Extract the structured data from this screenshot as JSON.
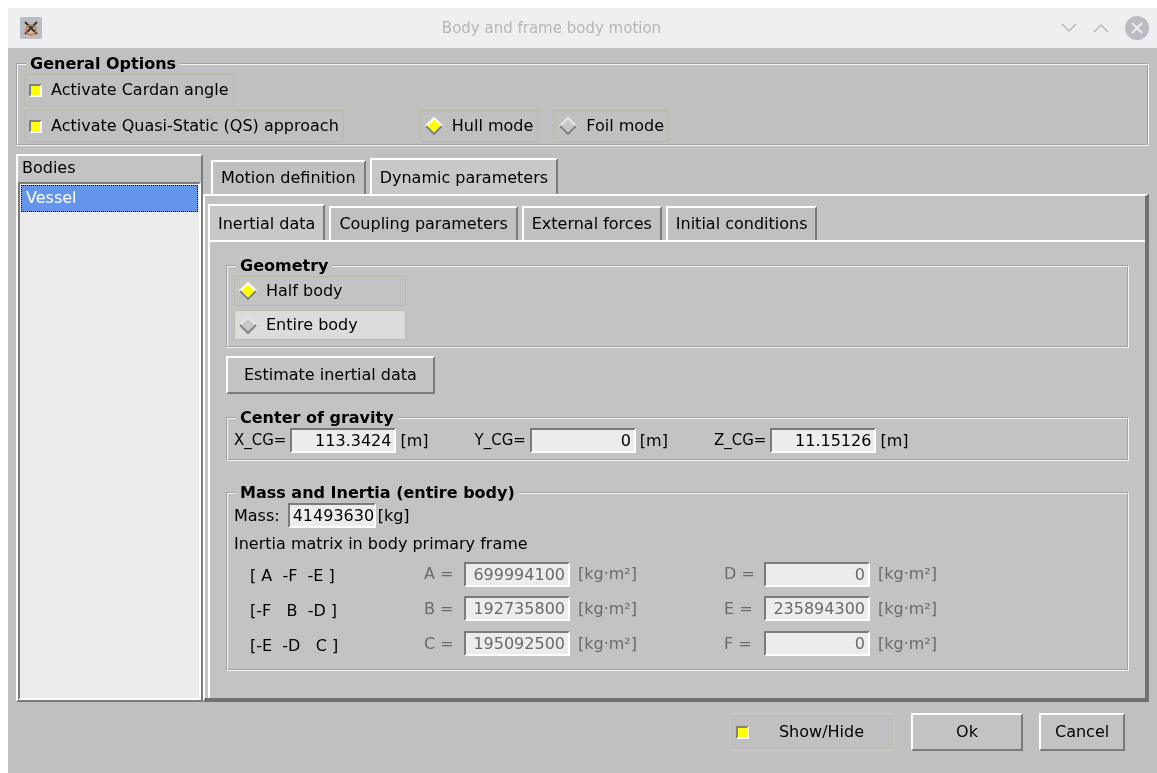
{
  "window": {
    "title": "Body and frame body motion"
  },
  "general_options": {
    "title": "General Options",
    "checkboxes": [
      {
        "label": "Activate Cardan angle",
        "checked": true
      },
      {
        "label": "Activate Quasi-Static (QS) approach",
        "checked": true
      }
    ],
    "modes": [
      {
        "label": "Hull mode",
        "selected": true
      },
      {
        "label": "Foil mode",
        "selected": false
      }
    ]
  },
  "bodies": {
    "title": "Bodies",
    "items": [
      {
        "label": "Vessel",
        "selected": true
      }
    ]
  },
  "tabs": [
    {
      "label": "Motion definition",
      "selected": false
    },
    {
      "label": "Dynamic parameters",
      "selected": true
    }
  ],
  "subtabs": [
    {
      "label": "Inertial data",
      "selected": true
    },
    {
      "label": "Coupling parameters",
      "selected": false
    },
    {
      "label": "External forces",
      "selected": false
    },
    {
      "label": "Initial conditions",
      "selected": false
    }
  ],
  "geometry": {
    "title": "Geometry",
    "options": [
      {
        "label": "Half body",
        "selected": true
      },
      {
        "label": "Entire body",
        "selected": false
      }
    ]
  },
  "estimate_button": "Estimate inertial data",
  "center_of_gravity": {
    "title": "Center of gravity",
    "fields": [
      {
        "label": "X_CG=",
        "value": "113.3424",
        "unit": "[m]"
      },
      {
        "label": "Y_CG=",
        "value": "0",
        "unit": "[m]"
      },
      {
        "label": "Z_CG=",
        "value": "11.15126",
        "unit": "[m]"
      }
    ]
  },
  "mass_inertia": {
    "title": "Mass and Inertia (entire body)",
    "mass": {
      "label": "Mass:",
      "value": "41493630",
      "unit": "[kg]"
    },
    "matrix_caption": "Inertia matrix in body primary frame",
    "matrix_rows": [
      "[ A  -F  -E ]",
      "[-F   B  -D ]",
      "[-E  -D   C ]"
    ],
    "components": [
      {
        "label": "A =",
        "value": "699994100",
        "unit": "[kg·m²]",
        "disabled": true
      },
      {
        "label": "D =",
        "value": "0",
        "unit": "[kg·m²]",
        "disabled": true
      },
      {
        "label": "B =",
        "value": "192735800",
        "unit": "[kg·m²]",
        "disabled": true
      },
      {
        "label": "E =",
        "value": "235894300",
        "unit": "[kg·m²]",
        "disabled": true
      },
      {
        "label": "C =",
        "value": "195092500",
        "unit": "[kg·m²]",
        "disabled": true
      },
      {
        "label": "F =",
        "value": "0",
        "unit": "[kg·m²]",
        "disabled": true
      }
    ]
  },
  "footer": {
    "show_hide": {
      "label": "Show/Hide",
      "checked": true
    },
    "buttons": [
      "Ok",
      "Cancel"
    ]
  }
}
